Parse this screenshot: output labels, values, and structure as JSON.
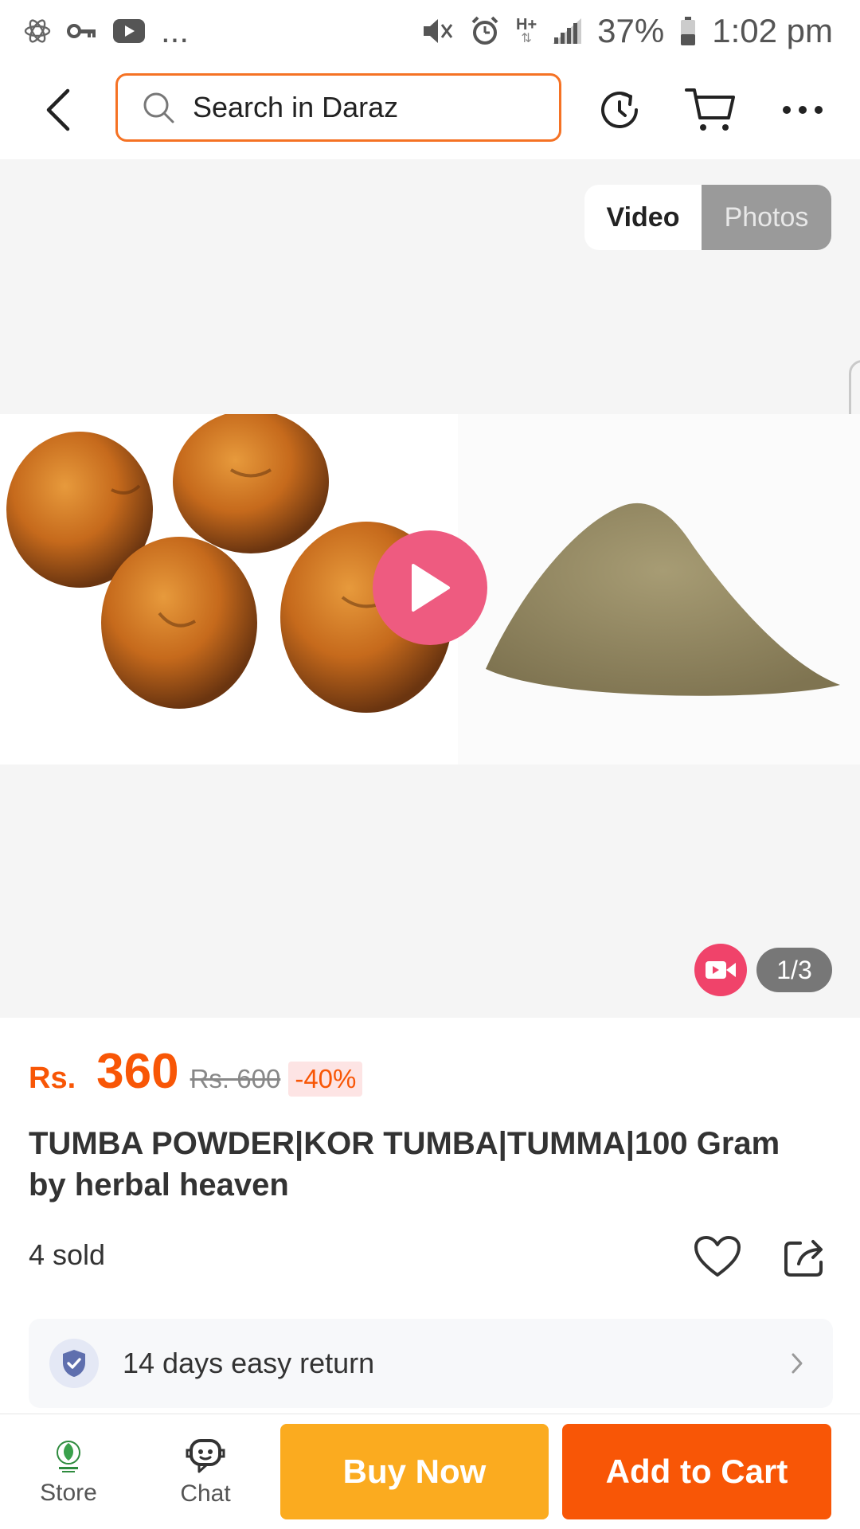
{
  "status_bar": {
    "battery": "37%",
    "time": "1:02 pm",
    "network_label": "H+",
    "overflow": "...",
    "icons": [
      "atom-icon",
      "vpn-key-icon",
      "youtube-icon",
      "mute-icon",
      "alarm-icon",
      "signal-icon",
      "battery-icon"
    ]
  },
  "top_nav": {
    "search_placeholder": "Search in Daraz",
    "icons": [
      "back-icon",
      "search-icon",
      "history-icon",
      "cart-icon",
      "more-icon"
    ]
  },
  "gallery": {
    "tabs": {
      "video": "Video",
      "photos": "Photos"
    },
    "active_tab": "Video",
    "counter": "1/3",
    "colors": {
      "play": "#ee5b80",
      "video_badge": "#f0436a"
    }
  },
  "product": {
    "currency": "Rs.",
    "price": "360",
    "original_price": "Rs. 600",
    "discount": "-40%",
    "title": "TUMBA POWDER|KOR TUMBA|TUMMA|100 Gram by herbal heaven",
    "sold": "4 sold",
    "accent_color": "#f85606"
  },
  "return_policy": {
    "label": "14 days easy return"
  },
  "bottom_bar": {
    "store": "Store",
    "chat": "Chat",
    "buy_now": "Buy Now",
    "add_to_cart": "Add to Cart",
    "colors": {
      "buy_now": "#fbab1f",
      "add_to_cart": "#f85606"
    }
  }
}
